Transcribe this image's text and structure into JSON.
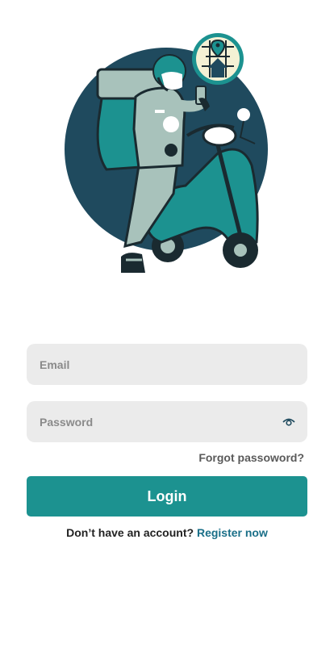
{
  "illustration": {
    "icon": "delivery-scooter-illustration",
    "colors": {
      "circle": "#1f4a5e",
      "teal": "#1c9290",
      "mint": "#a8c2bb",
      "dark": "#1a2a30",
      "badge_bg": "#f4f1d4"
    }
  },
  "form": {
    "email_placeholder": "Email",
    "password_placeholder": "Password",
    "forgot_label": "Forgot passoword?",
    "login_label": "Login",
    "register_prompt": "Don’t have an account?",
    "register_link": "Register now"
  },
  "colors": {
    "primary": "#1c9290",
    "link": "#1a6f88",
    "field_bg": "#ebebeb"
  }
}
